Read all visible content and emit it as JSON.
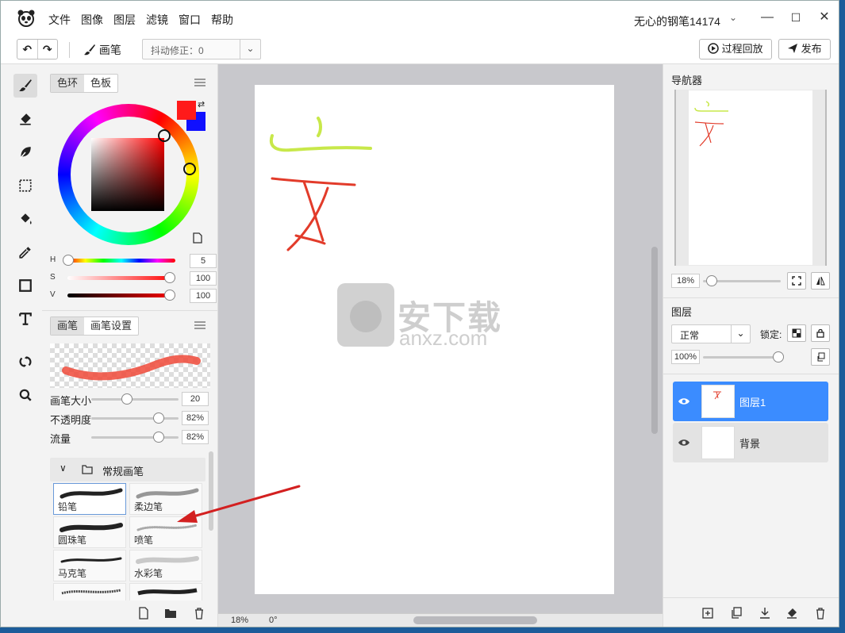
{
  "menu": [
    "文件",
    "图像",
    "图层",
    "滤镜",
    "窗口",
    "帮助"
  ],
  "user_name": "无心的钢笔14174",
  "window_controls": {
    "minimize": "—",
    "maximize": "☐",
    "close": "✕"
  },
  "toolbar": {
    "undo": "↶",
    "redo": "↷",
    "brush_label": "画笔",
    "stabilizer_label": "抖动修正：0",
    "replay_label": "过程回放",
    "publish_label": "发布"
  },
  "tools": [
    "brush-icon",
    "eraser-icon",
    "smudge-leaf-icon",
    "marquee-select-icon",
    "paint-bucket-icon",
    "eyedropper-icon",
    "rectangle-shape-icon",
    "text-icon",
    "transform-rotate-icon",
    "zoom-icon"
  ],
  "color_panel": {
    "tab_wheel": "色环",
    "tab_swatches": "色板",
    "primary_color": "#ff1a1a",
    "secondary_color": "#1010ff",
    "h_label": "H",
    "h_value": "5",
    "s_label": "S",
    "s_value": "100",
    "v_label": "V",
    "v_value": "100"
  },
  "brush_panel": {
    "tab_brush": "画笔",
    "tab_brush_settings": "画笔设置",
    "size_label": "画笔大小",
    "size_value": "20",
    "opacity_label": "不透明度",
    "opacity_value": "82%",
    "flow_label": "流量",
    "flow_value": "82%",
    "group_name": "常规画笔",
    "brushes": [
      "铅笔",
      "柔边笔",
      "圆珠笔",
      "喷笔",
      "马克笔",
      "水彩笔"
    ]
  },
  "status": {
    "zoom": "18%",
    "rotation": "0°"
  },
  "watermark": {
    "cn": "安下载",
    "en": "anxz.com"
  },
  "navigator": {
    "title": "导航器",
    "zoom_value": "18%"
  },
  "layers": {
    "title": "图层",
    "blend_mode": "正常",
    "lock_label": "锁定:",
    "opacity_value": "100%",
    "items": [
      {
        "name": "图层1"
      },
      {
        "name": "背景"
      }
    ]
  },
  "colors": {
    "accent": "#3b8cff",
    "annotation_arrow": "#d32020",
    "stroke_red": "#e23b2a",
    "stroke_yellow": "#c8e84a"
  }
}
